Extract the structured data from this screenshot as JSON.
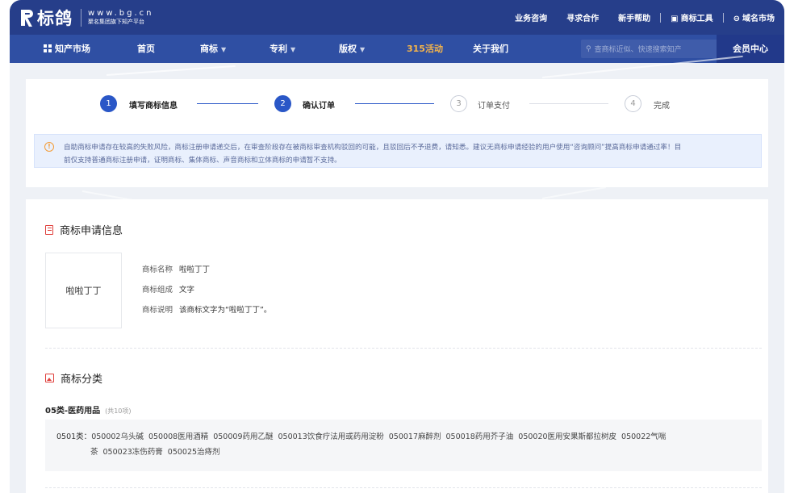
{
  "header": {
    "brand": "标鸽",
    "url": "www.bg.cn",
    "tagline": "聚名集团旗下知产平台",
    "links": [
      "业务咨询",
      "寻求合作",
      "新手帮助",
      "商标工具",
      "域名市场"
    ]
  },
  "nav": {
    "market": "知产市场",
    "items": [
      {
        "label": "首页",
        "caret": false
      },
      {
        "label": "商标",
        "caret": true
      },
      {
        "label": "专利",
        "caret": true
      },
      {
        "label": "版权",
        "caret": true
      },
      {
        "label": "315活动",
        "caret": false
      },
      {
        "label": "关于我们",
        "caret": false
      }
    ],
    "search_placeholder": "查商标近似、快速搜索知产",
    "member": "会员中心"
  },
  "steps": [
    {
      "num": "1",
      "label": "填写商标信息",
      "state": "done"
    },
    {
      "num": "2",
      "label": "确认订单",
      "state": "current"
    },
    {
      "num": "3",
      "label": "订单支付",
      "state": "todo"
    },
    {
      "num": "4",
      "label": "完成",
      "state": "todo"
    }
  ],
  "notice": {
    "line1": "自助商标申请存在较高的失败风险，商标注册申请递交后，在审查阶段存在被商标审查机构驳回的可能，且驳回后不予退费，请知悉。建议无商标申请经验的用户使用“咨询顾问”提高商标申请通过率！目",
    "line2": "前仅支持普通商标注册申请，证明商标、集体商标、声音商标和立体商标的申请暂不支持。"
  },
  "application": {
    "section_title": "商标申请信息",
    "preview_text": "啦啦丁丁",
    "name_label": "商标名称",
    "name_value": "啦啦丁丁",
    "composition_label": "商标组成",
    "composition_value": "文字",
    "desc_label": "商标说明",
    "desc_value": "该商标文字为“啦啦丁丁”。"
  },
  "classification": {
    "section_title": "商标分类",
    "class_name": "05类-医药用品",
    "count": "(共10项)",
    "group_label": "0501类：",
    "items_line1": [
      "050002乌头碱",
      "050008医用酒精",
      "050009药用乙醚",
      "050013饮食疗法用或药用淀粉",
      "050017麻醉剂",
      "050018药用芥子油",
      "050020医用安果斯都拉树皮",
      "050022气喘"
    ],
    "items_line2": [
      "茶",
      "050023冻伤药膏",
      "050025治痔剂"
    ]
  }
}
